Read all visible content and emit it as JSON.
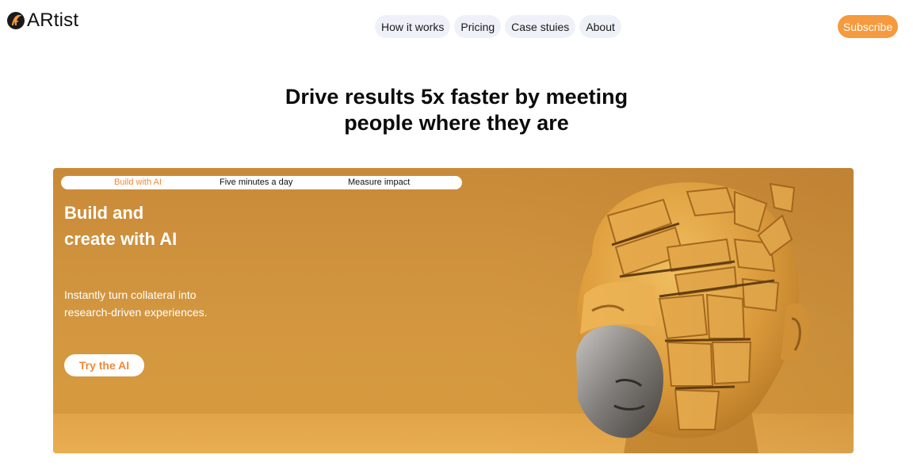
{
  "header": {
    "logo_text": "ARtist",
    "nav": [
      "How it works",
      "Pricing",
      "Case stuies",
      "About"
    ],
    "subscribe_label": "Subscribe"
  },
  "headline": {
    "line1": "Drive results 5x faster by meeting",
    "line2": "people where they are"
  },
  "hero": {
    "tabs": [
      "Build with AI",
      "Five minutes a day",
      "Measure impact"
    ],
    "active_tab": "Build with AI",
    "title_line1": "Build and",
    "title_line2": "create with AI",
    "desc_line1": "Instantly turn collateral into",
    "desc_line2": "research-driven experiences.",
    "cta_label": "Try the AI",
    "image_icon": "fractured-metal-head-image"
  },
  "colors": {
    "accent": "#f59a3e",
    "accent_text": "#f0883a",
    "hero_bg": "#d39740",
    "nav_pill": "#eef1f8"
  }
}
